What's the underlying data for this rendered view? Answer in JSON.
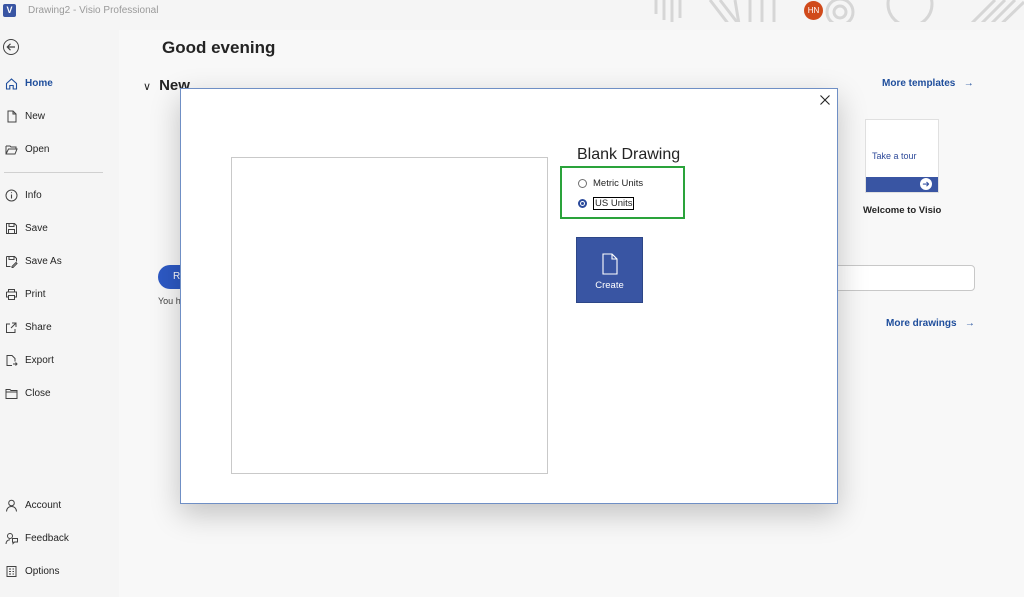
{
  "titlebar": {
    "app_logo": "V",
    "title": "Drawing2  -  Visio Professional",
    "avatar_initials": "HN"
  },
  "nav": {
    "items": [
      {
        "label": "Home",
        "icon": "home-icon",
        "active": true
      },
      {
        "label": "New",
        "icon": "new-document-icon"
      },
      {
        "label": "Open",
        "icon": "folder-open-icon"
      },
      {
        "label": "Info",
        "icon": "info-icon"
      },
      {
        "label": "Save",
        "icon": "save-icon"
      },
      {
        "label": "Save As",
        "icon": "save-as-icon"
      },
      {
        "label": "Print",
        "icon": "printer-icon"
      },
      {
        "label": "Share",
        "icon": "share-icon"
      },
      {
        "label": "Export",
        "icon": "export-icon"
      },
      {
        "label": "Close",
        "icon": "folder-close-icon"
      },
      {
        "label": "Account",
        "icon": "person-icon"
      },
      {
        "label": "Feedback",
        "icon": "feedback-icon"
      },
      {
        "label": "Options",
        "icon": "options-icon"
      }
    ]
  },
  "main": {
    "greeting": "Good evening",
    "new_section": "New",
    "more_templates": "More templates",
    "tour_card_text": "Take a tour",
    "tour_card_label": "Welcome to Visio",
    "recent_button_partial": "R",
    "recent_text_partial": "You h",
    "more_drawings": "More drawings"
  },
  "dialog": {
    "title": "Blank Drawing",
    "units": {
      "options": [
        "Metric Units",
        "US Units"
      ],
      "selected": "US Units"
    },
    "create_label": "Create",
    "colors": {
      "create_button": "#3955a3",
      "highlight_border": "#2aa33b"
    }
  }
}
